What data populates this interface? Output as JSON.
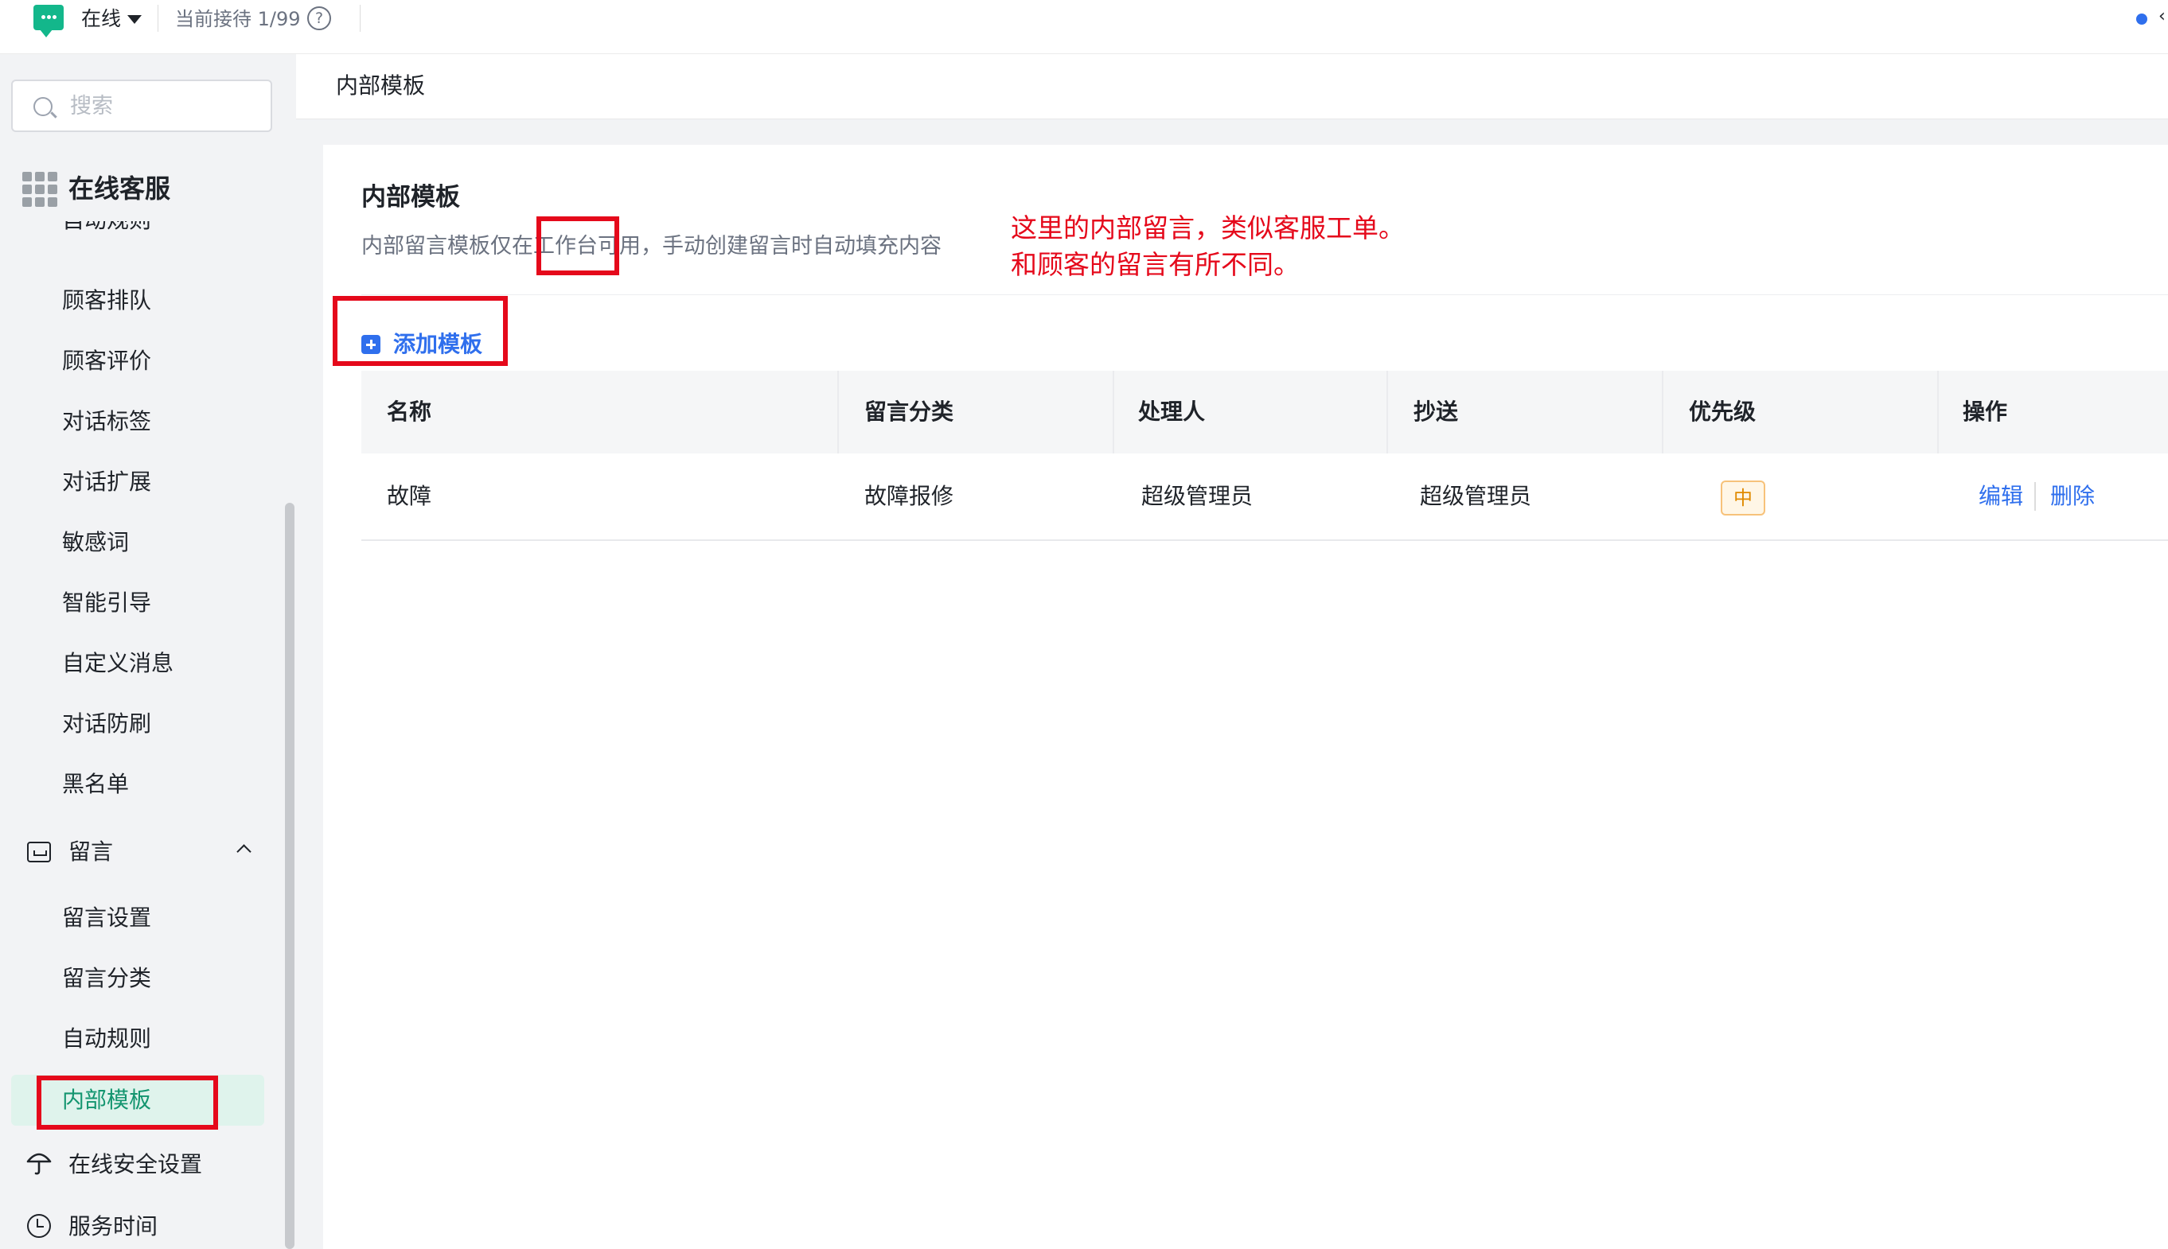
{
  "topbar": {
    "status": "在线",
    "queue": "当前接待 1/99",
    "help_symbol": "?",
    "colors": {
      "status_icon": "#13b78b",
      "dot": "#2f6fed"
    }
  },
  "sidebar": {
    "search_placeholder": "搜索",
    "module_title": "在线客服",
    "cut_item": "自动规则",
    "items": [
      "顾客排队",
      "顾客评价",
      "对话标签",
      "对话扩展",
      "敏感词",
      "智能引导",
      "自定义消息",
      "对话防刷",
      "黑名单"
    ],
    "group_label": "留言",
    "group_items": [
      "留言设置",
      "留言分类",
      "自动规则"
    ],
    "active_item": "内部模板",
    "bottom_items": [
      "在线安全设置",
      "服务时间"
    ],
    "icons": [
      "search-icon",
      "grid-icon",
      "inbox-icon",
      "chevron-up-icon",
      "umbrella-icon",
      "clock-icon"
    ],
    "active_color": "#13956f"
  },
  "main": {
    "breadcrumb": "内部模板",
    "title": "内部模板",
    "description": "内部留言模板仅在工作台可用，手动创建留言时自动填充内容",
    "add_button": "添加模板",
    "accent": "#2f6fed",
    "table": {
      "headers": [
        "名称",
        "留言分类",
        "处理人",
        "抄送",
        "优先级",
        "操作"
      ],
      "rows": [
        {
          "name": "故障",
          "category": "故障报修",
          "handler": "超级管理员",
          "cc": "超级管理员",
          "priority": "中",
          "edit": "编辑",
          "delete": "删除"
        }
      ]
    }
  },
  "annotation": {
    "line1": "这里的内部留言，类似客服工单。",
    "line2": "和顾客的留言有所不同。",
    "color": "#e5091b"
  }
}
